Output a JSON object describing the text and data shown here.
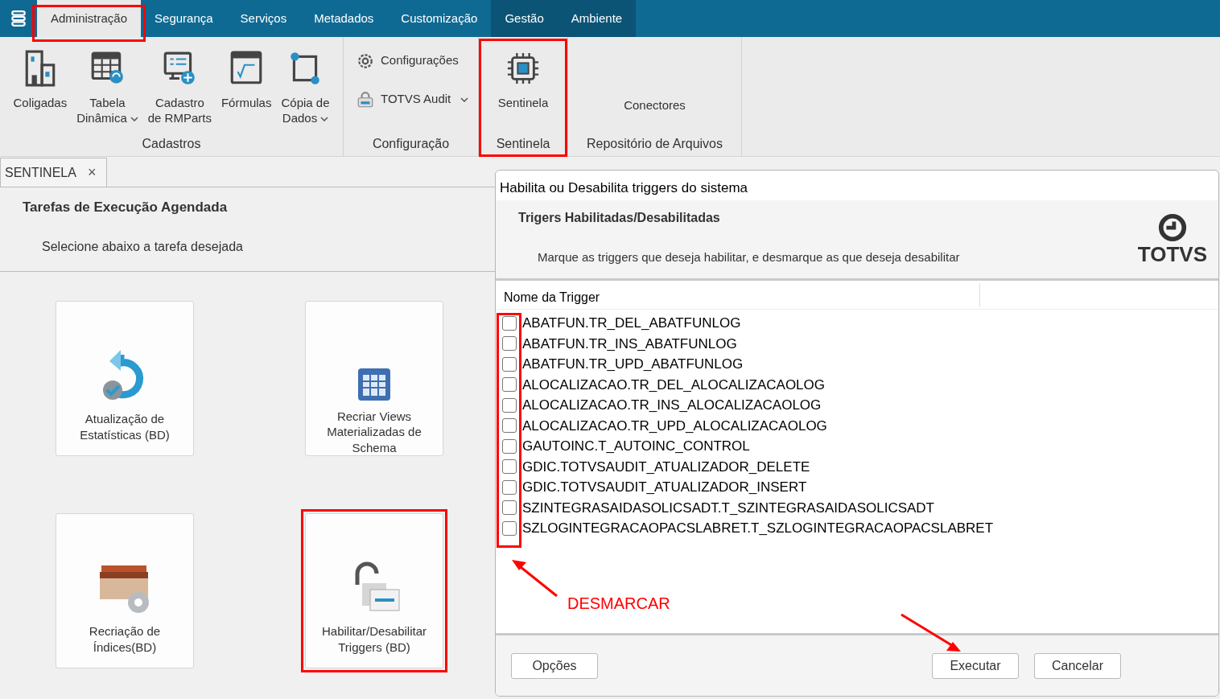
{
  "menu_tabs": [
    {
      "label": "Administração",
      "selected": true,
      "kind": "main",
      "highlighted": true
    },
    {
      "label": "Segurança",
      "selected": false,
      "kind": "main",
      "highlighted": false
    },
    {
      "label": "Serviços",
      "selected": false,
      "kind": "main",
      "highlighted": false
    },
    {
      "label": "Metadados",
      "selected": false,
      "kind": "main",
      "highlighted": false
    },
    {
      "label": "Customização",
      "selected": false,
      "kind": "main",
      "highlighted": false
    },
    {
      "label": "Gestão",
      "selected": false,
      "kind": "context",
      "highlighted": false
    },
    {
      "label": "Ambiente",
      "selected": false,
      "kind": "context",
      "highlighted": false
    }
  ],
  "ribbon_groups": [
    {
      "label": "Cadastros",
      "items": [
        {
          "kind": "large",
          "lines": [
            "Coligadas"
          ],
          "highlighted": false
        },
        {
          "kind": "large",
          "lines": [
            "Tabela",
            "Dinâmica"
          ],
          "dropdown": true,
          "highlighted": false
        },
        {
          "kind": "large",
          "lines": [
            "Cadastro",
            "de RMParts"
          ],
          "highlighted": false
        },
        {
          "kind": "large",
          "lines": [
            "Fórmulas"
          ],
          "highlighted": false
        },
        {
          "kind": "large",
          "lines": [
            "Cópia de",
            "Dados"
          ],
          "dropdown": true,
          "highlighted": false
        }
      ]
    },
    {
      "label": "Configuração",
      "items": [
        {
          "kind": "small",
          "lines": [
            "Configurações"
          ],
          "highlighted": false
        },
        {
          "kind": "small",
          "lines": [
            "TOTVS Audit"
          ],
          "dropdown": true,
          "highlighted": false
        }
      ]
    },
    {
      "label": "Sentinela",
      "items": [
        {
          "kind": "large",
          "lines": [
            "Sentinela"
          ],
          "highlighted": true
        }
      ]
    },
    {
      "label": "Repositório de Arquivos",
      "items": [
        {
          "kind": "text",
          "lines": [
            "Conectores"
          ],
          "highlighted": false
        }
      ]
    }
  ],
  "doc_tab": {
    "label": "SENTINELA",
    "close": "×"
  },
  "tasks_panel": {
    "title": "Tarefas de Execução Agendada",
    "subtitle": "Selecione abaixo a tarefa desejada",
    "tiles": [
      {
        "lines": [
          "Atualização de",
          "Estatísticas (BD)"
        ],
        "highlighted": false
      },
      {
        "lines": [
          "Recriar Views",
          "Materializadas de",
          "Schema"
        ],
        "highlighted": false
      },
      {
        "lines": [
          "Recriação de",
          "Índices(BD)"
        ],
        "highlighted": false
      },
      {
        "lines": [
          "Habilitar/Desabilitar",
          "Triggers (BD)"
        ],
        "highlighted": true
      }
    ]
  },
  "dialog": {
    "title": "Habilita ou Desabilita triggers do sistema",
    "heading": "Trigers Habilitadas/Desabilitadas",
    "instruction": "Marque as triggers que deseja habilitar, e desmarque as que deseja desabilitar",
    "logo_text": "TOTVS",
    "column": "Nome da Trigger",
    "checkboxes_highlighted": true,
    "triggers": [
      {
        "name": "ABATFUN.TR_DEL_ABATFUNLOG",
        "checked": false
      },
      {
        "name": "ABATFUN.TR_INS_ABATFUNLOG",
        "checked": false
      },
      {
        "name": "ABATFUN.TR_UPD_ABATFUNLOG",
        "checked": false
      },
      {
        "name": "ALOCALIZACAO.TR_DEL_ALOCALIZACAOLOG",
        "checked": false
      },
      {
        "name": "ALOCALIZACAO.TR_INS_ALOCALIZACAOLOG",
        "checked": false
      },
      {
        "name": "ALOCALIZACAO.TR_UPD_ALOCALIZACAOLOG",
        "checked": false
      },
      {
        "name": "GAUTOINC.T_AUTOINC_CONTROL",
        "checked": false
      },
      {
        "name": "GDIC.TOTVSAUDIT_ATUALIZADOR_DELETE",
        "checked": false
      },
      {
        "name": "GDIC.TOTVSAUDIT_ATUALIZADOR_INSERT",
        "checked": false
      },
      {
        "name": "SZINTEGRASAIDASOLICSADT.T_SZINTEGRASAIDASOLICSADT",
        "checked": false
      },
      {
        "name": "SZLOGINTEGRACAOPACSLABRET.T_SZLOGINTEGRACAOPACSLABRET",
        "checked": false
      }
    ],
    "buttons": [
      {
        "label": "Opções"
      },
      {
        "label": "Executar",
        "arrow": true
      },
      {
        "label": "Cancelar"
      }
    ]
  },
  "annotation": {
    "label": "DESMARCAR"
  }
}
